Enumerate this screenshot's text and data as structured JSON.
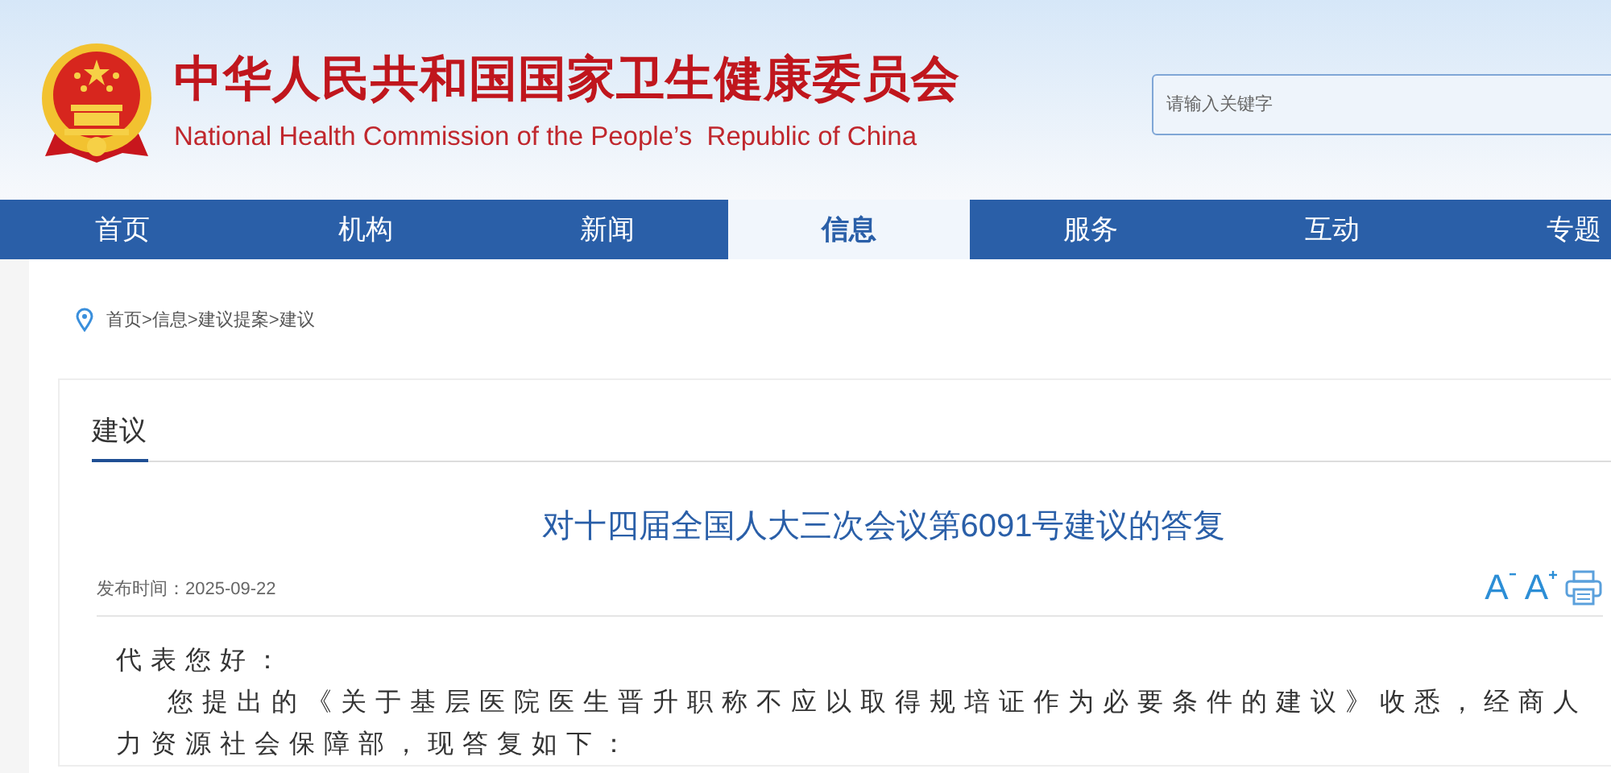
{
  "header": {
    "title_cn": "中华人民共和国国家卫生健康委员会",
    "title_en": "National Health Commission of the People’s  Republic of China",
    "search": {
      "placeholder": "请输入关键字"
    }
  },
  "nav": [
    {
      "label": "首页",
      "selected": false
    },
    {
      "label": "机构",
      "selected": false
    },
    {
      "label": "新闻",
      "selected": false
    },
    {
      "label": "信息",
      "selected": true
    },
    {
      "label": "服务",
      "selected": false
    },
    {
      "label": "互动",
      "selected": false
    },
    {
      "label": "专题",
      "selected": false
    }
  ],
  "breadcrumb": "首页>信息>建议提案>建议",
  "section_title": "建议",
  "article": {
    "title": "对十四届全国人大三次会议第6091号建议的答复",
    "date_label": "发布时间：",
    "date": "2025-09-22",
    "font_smaller": "A",
    "font_larger": "A",
    "paragraphs": [
      {
        "text": "代表您好：",
        "indent": false
      },
      {
        "text": "您提出的《关于基层医院医生晋升职称不应以取得规培证作为必要条件的建议》收悉，经商人力资源社会保障部，现答复如下：",
        "indent": true
      }
    ]
  }
}
